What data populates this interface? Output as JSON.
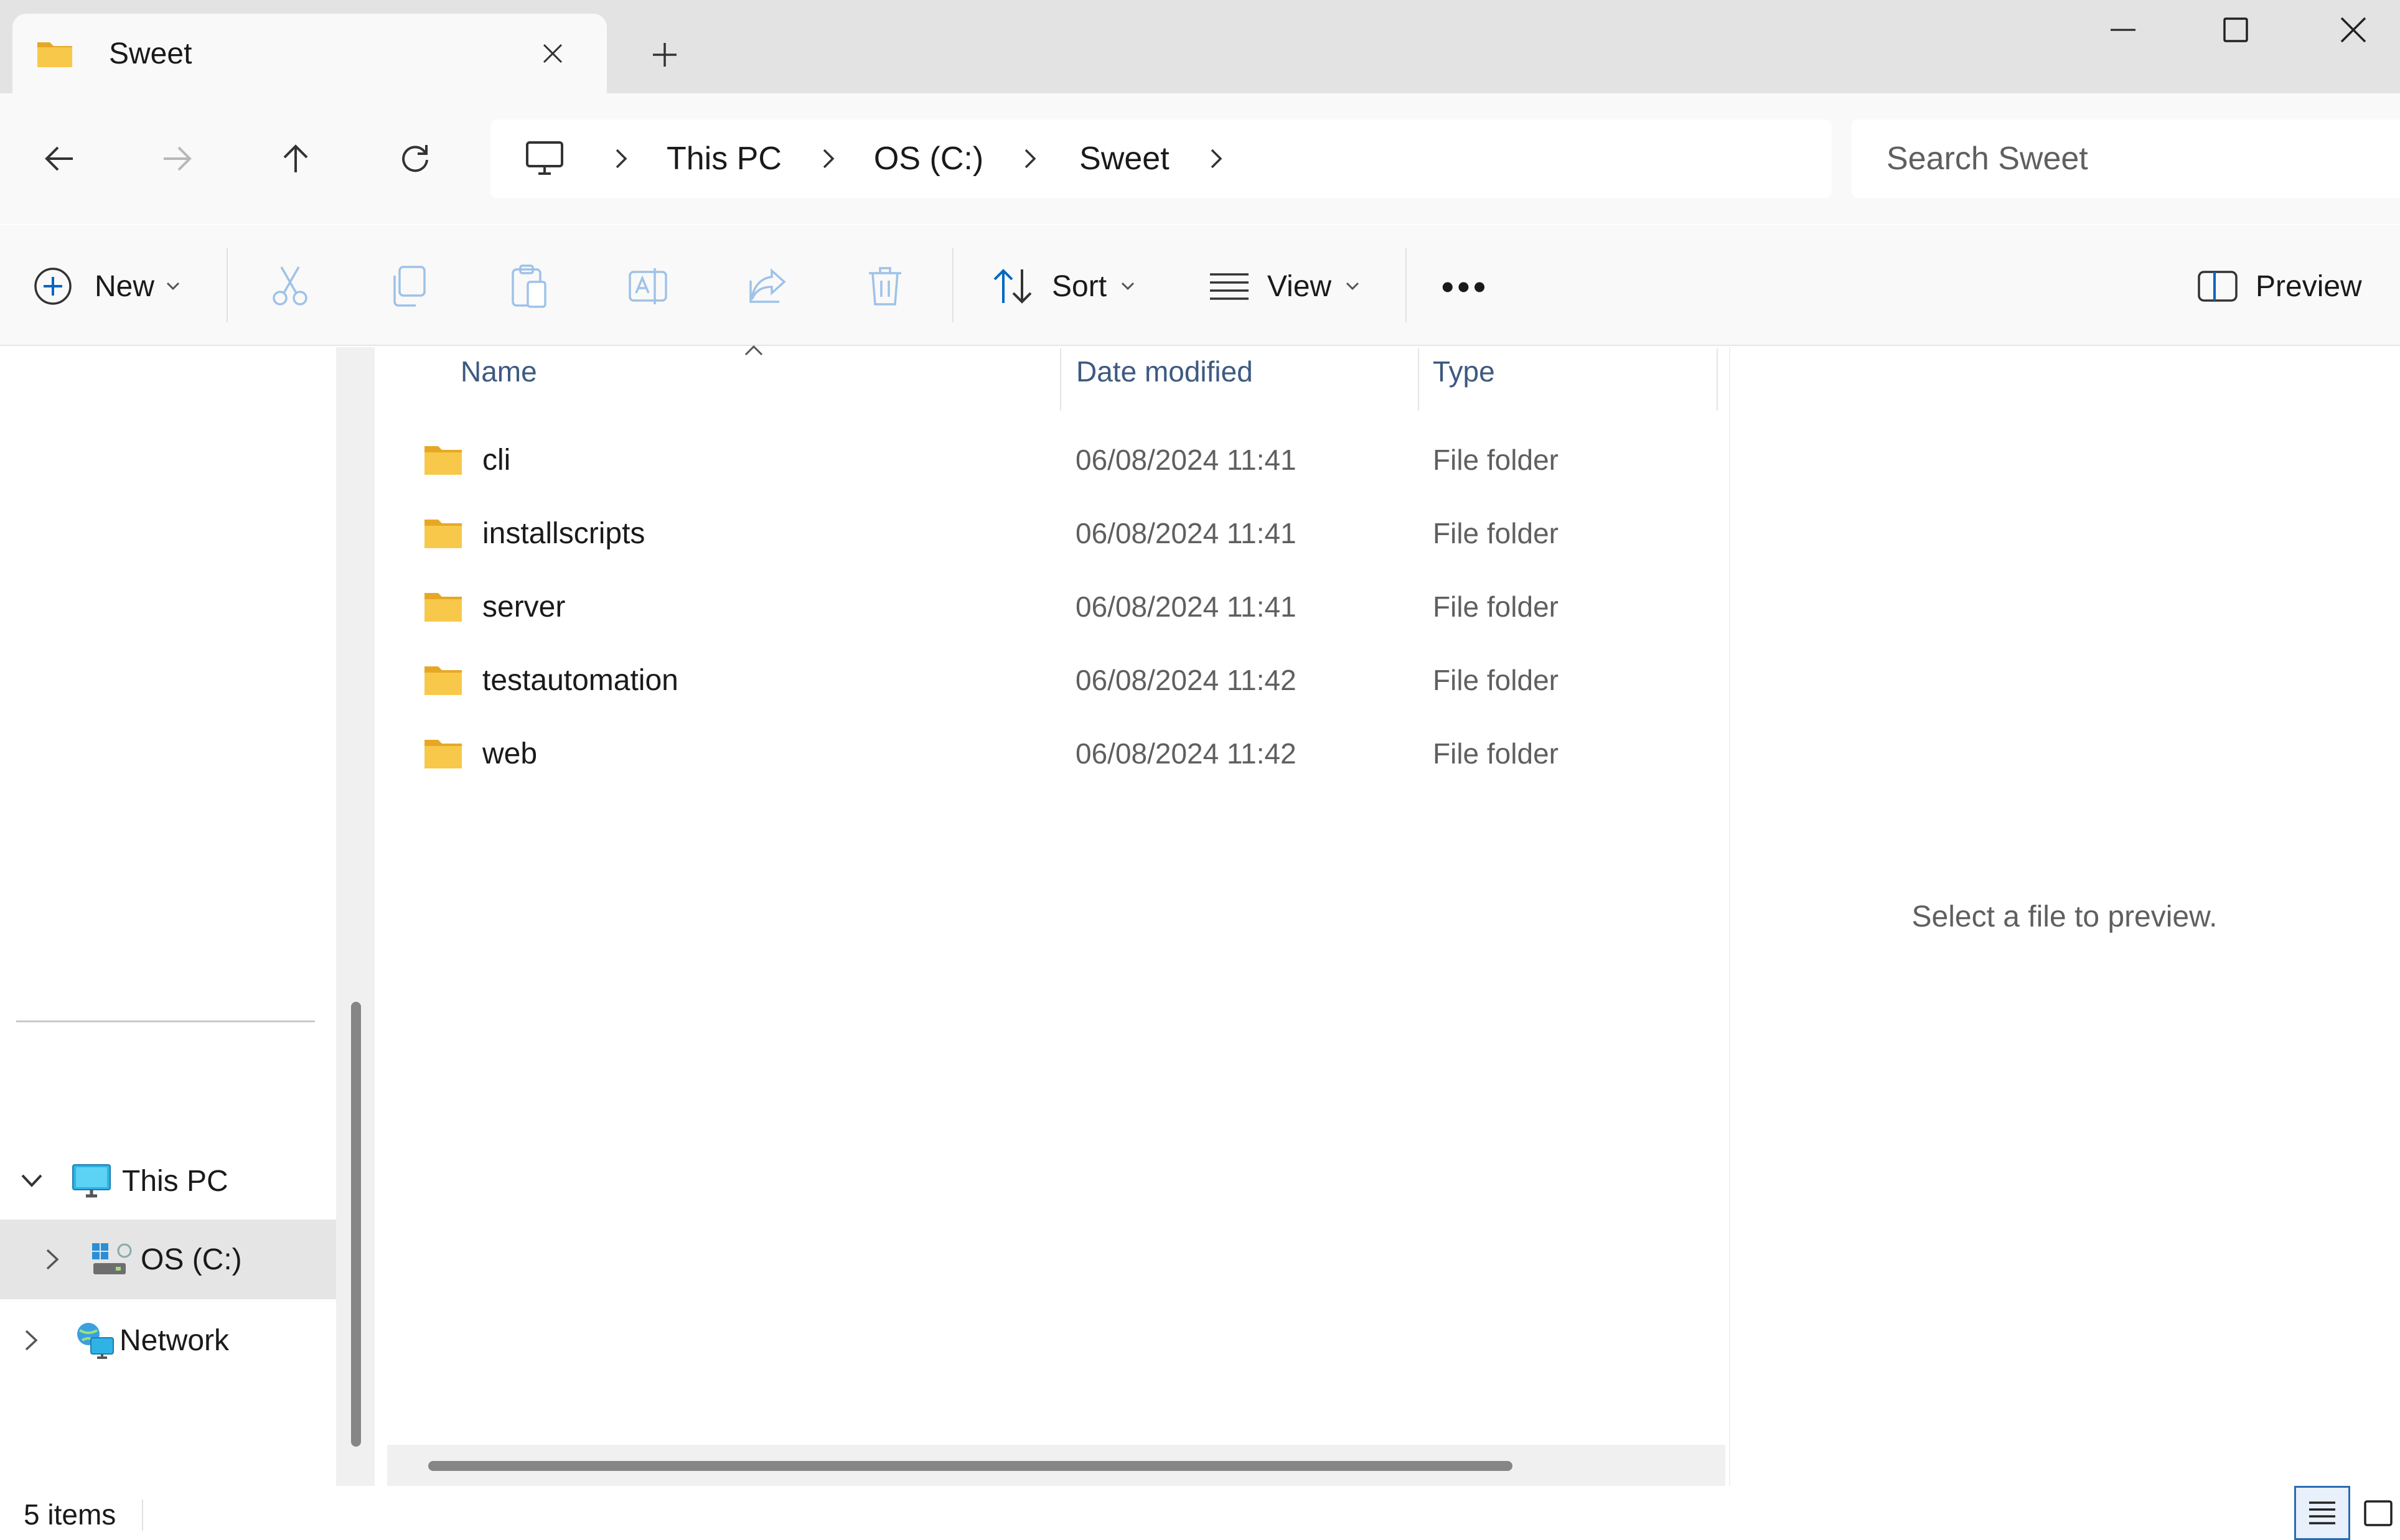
{
  "window": {
    "tab_title": "Sweet",
    "tab_icon": "folder-icon",
    "new_tab": "+",
    "controls": [
      "minimize",
      "maximize",
      "close"
    ]
  },
  "address": {
    "segments": [
      "This PC",
      "OS (C:)",
      "Sweet"
    ],
    "search_placeholder": "Search Sweet"
  },
  "toolbar": {
    "new_label": "New",
    "sort_label": "Sort",
    "view_label": "View",
    "more_label": "•••",
    "preview_label": "Preview"
  },
  "nav": {
    "items": [
      {
        "label": "This PC",
        "expanded": true,
        "icon": "monitor-icon"
      },
      {
        "label": "OS (C:)",
        "selected": true,
        "icon": "drive-icon"
      },
      {
        "label": "Network",
        "icon": "network-icon"
      }
    ]
  },
  "columns": {
    "name": "Name",
    "date": "Date modified",
    "type": "Type"
  },
  "files": [
    {
      "name": "cli",
      "date": "06/08/2024 11:41",
      "type": "File folder"
    },
    {
      "name": "installscripts",
      "date": "06/08/2024 11:41",
      "type": "File folder"
    },
    {
      "name": "server",
      "date": "06/08/2024 11:41",
      "type": "File folder"
    },
    {
      "name": "testautomation",
      "date": "06/08/2024 11:42",
      "type": "File folder"
    },
    {
      "name": "web",
      "date": "06/08/2024 11:42",
      "type": "File folder"
    }
  ],
  "preview": {
    "message": "Select a file to preview."
  },
  "status": {
    "items_count": "5 items"
  },
  "colors": {
    "accent": "#0067c0",
    "folder": "#f8c84a",
    "folder_dark": "#e6a824",
    "header_text": "#3d5a80"
  }
}
